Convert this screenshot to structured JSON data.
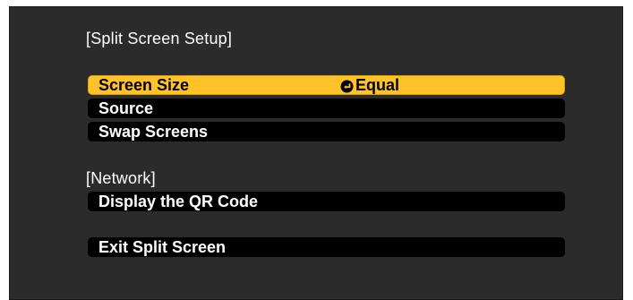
{
  "menu": {
    "title": "[Split Screen Setup]",
    "items": [
      {
        "label": "Screen Size",
        "value": "Equal",
        "selected": true
      },
      {
        "label": "Source"
      },
      {
        "label": "Swap Screens"
      }
    ]
  },
  "network": {
    "title": "[Network]",
    "items": [
      {
        "label": "Display the QR Code"
      }
    ]
  },
  "exit": {
    "label": "Exit Split Screen"
  },
  "colors": {
    "panel_bg": "#2b2b2b",
    "item_bg": "#000000",
    "highlight": "#ffc329",
    "text": "#ffffff"
  },
  "icons": {
    "value_indicator": "enter-icon"
  }
}
